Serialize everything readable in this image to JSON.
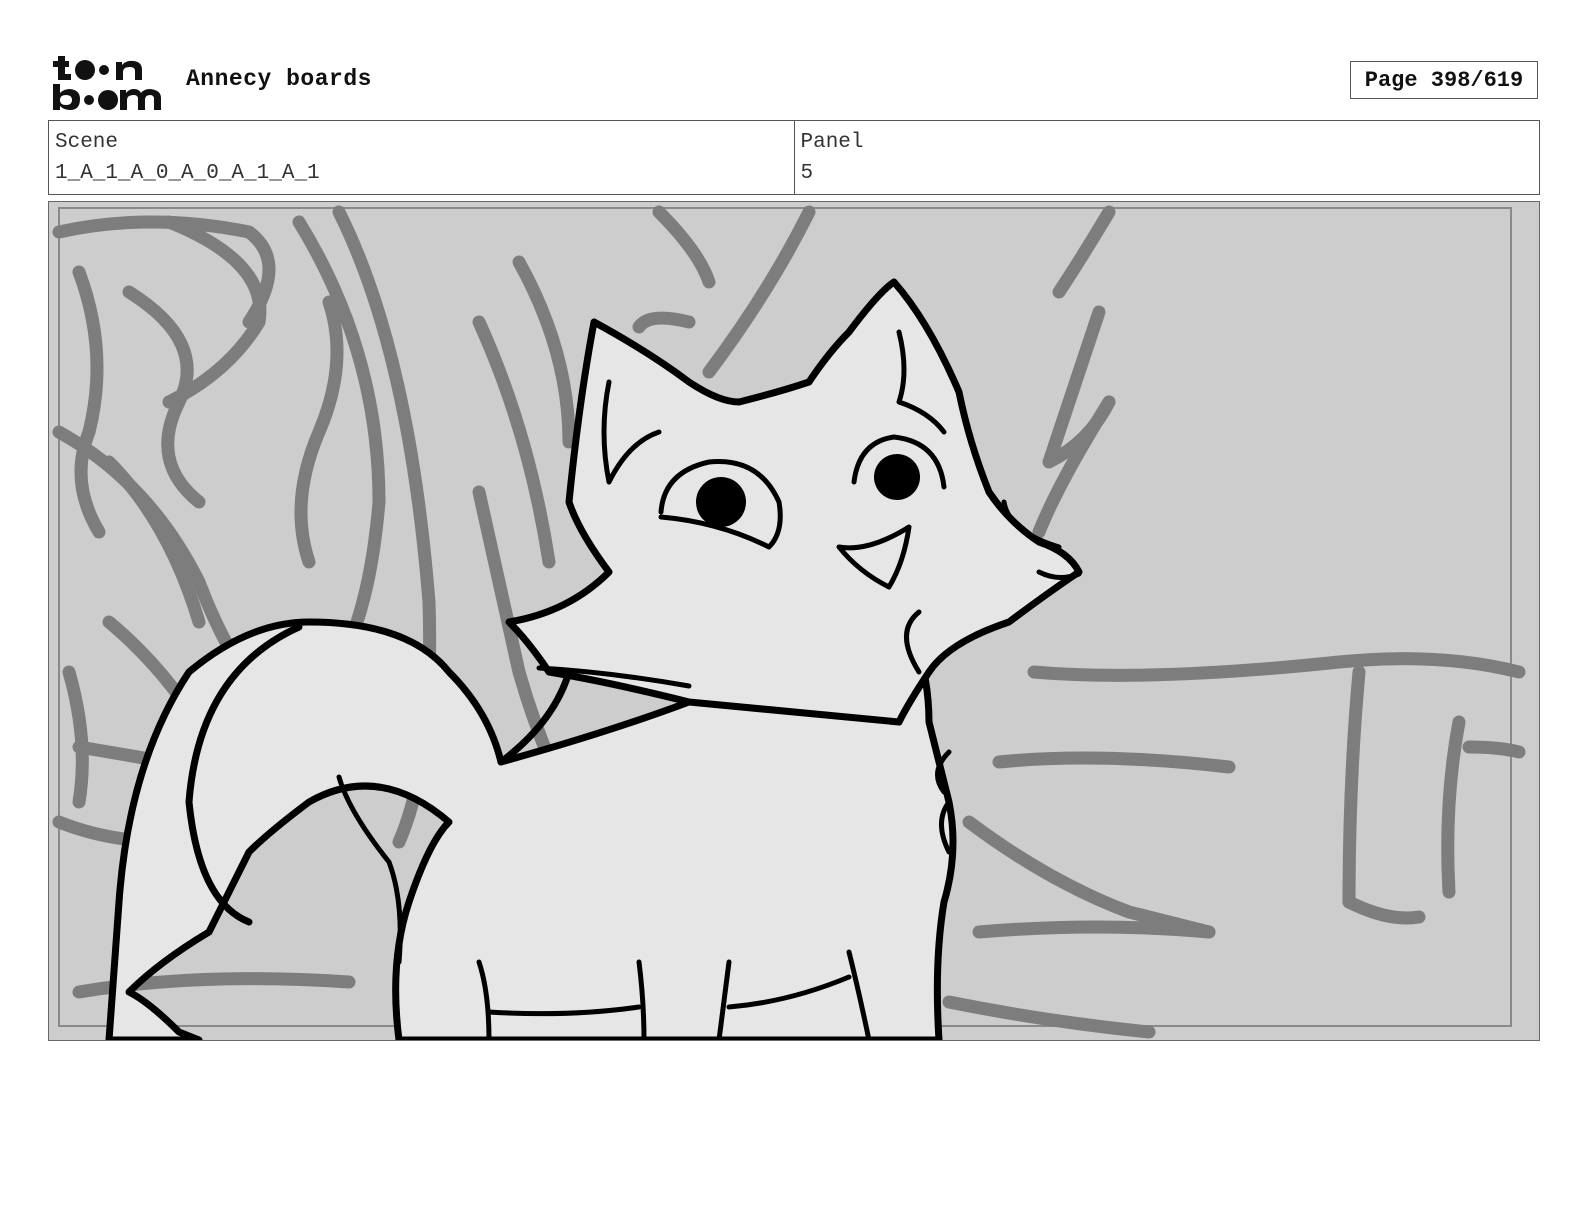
{
  "header": {
    "logo_alt": "toon boom",
    "app_title": "Annecy boards",
    "page_label": "Page 398/619"
  },
  "info": {
    "scene_label": "Scene",
    "scene_value": "1_A_1_A_0_A_0_A_1_A_1",
    "panel_label": "Panel",
    "panel_value": "5"
  },
  "colors": {
    "background": "#cdcdcd",
    "background_strokes": "#7d7d7d",
    "character_fill": "#e6e6e6",
    "ink": "#000000"
  },
  "panel_image": {
    "icon": "storyboard-sketch-cat"
  }
}
